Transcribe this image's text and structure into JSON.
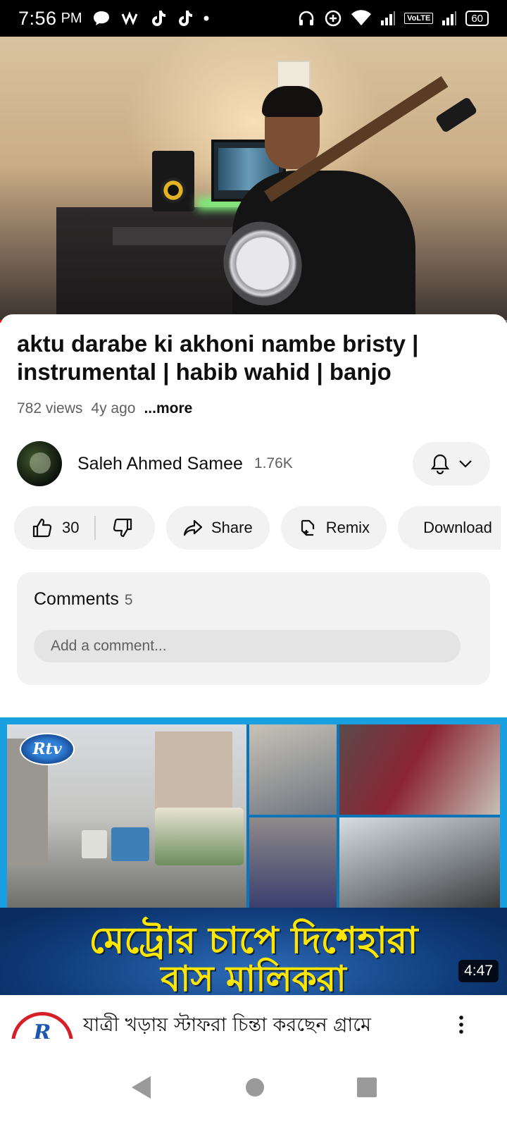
{
  "status_bar": {
    "time": "7:56",
    "ampm": "PM",
    "volte": "VoLTE",
    "battery": "60"
  },
  "player": {
    "progress_fraction": 0.33,
    "buffer_fraction": 0.64
  },
  "video": {
    "title": "aktu darabe ki akhoni nambe bristy | instrumental | habib wahid | banjo",
    "views": "782 views",
    "age": "4y ago",
    "more": "...more"
  },
  "channel": {
    "name": "Saleh Ahmed Samee",
    "subscribers": "1.76K"
  },
  "actions": {
    "likes": "30",
    "share": "Share",
    "remix": "Remix",
    "download": "Download"
  },
  "comments": {
    "title": "Comments",
    "count": "5",
    "placeholder": "Add a comment..."
  },
  "next_video": {
    "logo": "Rtv",
    "banner_line1": "মেট্রোর চাপে দিশেহারা",
    "banner_line2": "বাস মালিকরা",
    "duration": "4:47",
    "channel_logo": "R",
    "title": "যাত্রী খড়ায় স্টাফরা চিন্তা করছেন গ্রামে"
  },
  "icons": {
    "status": [
      "chat-bubble-icon",
      "signal-wave-icon",
      "tiktok-icon",
      "tiktok-icon",
      "headphones-icon",
      "data-saver-icon",
      "wifi-icon",
      "cell-signal-icon",
      "battery-icon"
    ],
    "nav": [
      "back-icon",
      "home-icon",
      "recents-icon"
    ]
  },
  "colors": {
    "accent_red": "#ff0000",
    "banner_text": "#ffe600",
    "chip_bg": "#f2f2f2"
  }
}
